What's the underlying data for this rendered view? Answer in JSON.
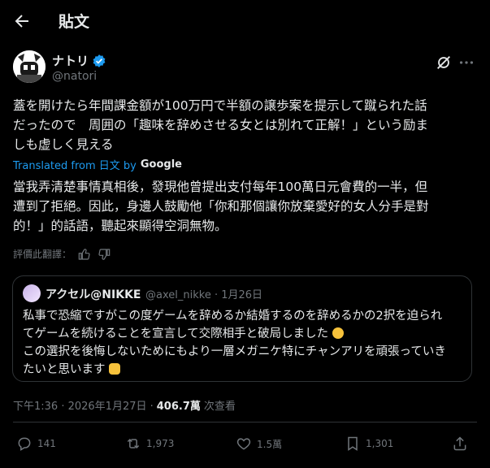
{
  "header": {
    "title": "貼文"
  },
  "author": {
    "name": "ナトリ",
    "handle": "@natori"
  },
  "post": {
    "line1": "蓋を開けたら年間課金額が100万円で半額の譲歩案を提示して蹴られた話",
    "line2": "だったので　周囲の「趣味を辞めさせる女とは別れて正解！」という励ま",
    "line3": "しも虚しく見える"
  },
  "translation": {
    "label": "Translated from 日文 by",
    "provider": "Google",
    "line1": "當我弄清楚事情真相後，發現他曾提出支付每年100萬日元會費的一半，但",
    "line2": "遭到了拒絕。因此，身邊人鼓勵他「你和那個讓你放棄愛好的女人分手是對",
    "line3": "的！」的話語，聽起來顯得空洞無物。"
  },
  "rating": {
    "label": "評價此翻譯："
  },
  "quote": {
    "name": "アクセル@NIKKE",
    "handle_date": "@axel_nikke · 1月26日",
    "line1": "私事で恐縮ですがこの度ゲームを辞めるか結婚するのを辞めるかの2択を迫られ",
    "line2": "てゲームを続けることを宣言して交際相手と破局しました",
    "line3": "この選択を後悔しないためにもより一層メガニケ特にチャンアリを頑張っていき",
    "line4": "たいと思います"
  },
  "meta": {
    "time": "下午1:36 · 2026年1月27日 ·",
    "views": "406.7萬",
    "views_label": "次查看"
  },
  "actions": {
    "replies": "141",
    "reposts": "1,973",
    "likes": "1.5萬",
    "bookmarks": "1,301"
  },
  "colors": {
    "accent": "#1d9bf0",
    "muted": "#71767b",
    "border": "#2f3336"
  }
}
